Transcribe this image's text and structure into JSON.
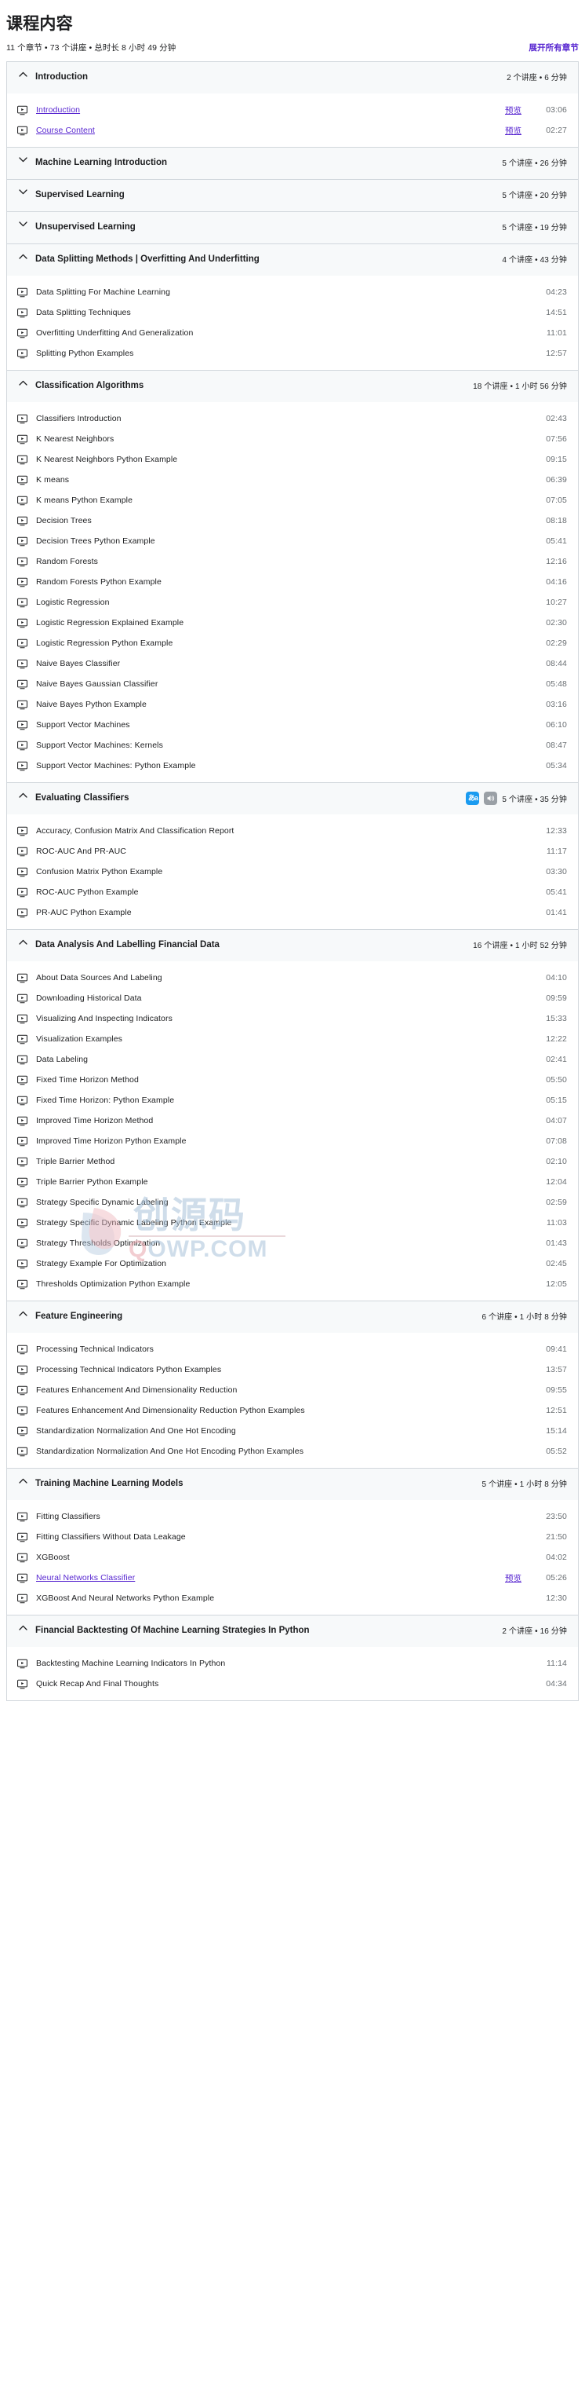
{
  "header": {
    "title": "课程内容",
    "meta": "11 个章节 • 73 个讲座 • 总时长 8 小时 49 分钟",
    "expand_all": "展开所有章节"
  },
  "watermark": {
    "cn": "创源码",
    "domain_prefix": "Q",
    "domain_rest": "OWP.COM"
  },
  "labels": {
    "preview": "预览"
  },
  "colors": {
    "accent": "#5624d0",
    "section_bg": "#f7f9fa",
    "border": "#d1d7dc",
    "duration": "#6a6f73",
    "badge_translate": "#1a9bf0",
    "badge_speaker": "#9aa0a6"
  },
  "sections": [
    {
      "title": "Introduction",
      "meta": "2 个讲座 • 6 分钟",
      "expanded": true,
      "badges": [],
      "lectures": [
        {
          "title": "Introduction",
          "duration": "03:06",
          "link": true,
          "preview": "预览"
        },
        {
          "title": "Course Content",
          "duration": "02:27",
          "link": true,
          "preview": "预览"
        }
      ]
    },
    {
      "title": "Machine Learning Introduction",
      "meta": "5 个讲座 • 26 分钟",
      "expanded": false,
      "badges": [],
      "lectures": []
    },
    {
      "title": "Supervised Learning",
      "meta": "5 个讲座 • 20 分钟",
      "expanded": false,
      "badges": [],
      "lectures": []
    },
    {
      "title": "Unsupervised Learning",
      "meta": "5 个讲座 • 19 分钟",
      "expanded": false,
      "badges": [],
      "lectures": []
    },
    {
      "title": "Data Splitting Methods | Overfitting And Underfitting",
      "meta": "4 个讲座 • 43 分钟",
      "expanded": true,
      "badges": [],
      "lectures": [
        {
          "title": "Data Splitting For Machine Learning",
          "duration": "04:23",
          "link": false,
          "preview": ""
        },
        {
          "title": "Data Splitting Techniques",
          "duration": "14:51",
          "link": false,
          "preview": ""
        },
        {
          "title": "Overfitting Underfitting And Generalization",
          "duration": "11:01",
          "link": false,
          "preview": ""
        },
        {
          "title": "Splitting Python Examples",
          "duration": "12:57",
          "link": false,
          "preview": ""
        }
      ]
    },
    {
      "title": "Classification Algorithms",
      "meta": "18 个讲座 • 1 小时 56 分钟",
      "expanded": true,
      "badges": [],
      "lectures": [
        {
          "title": "Classifiers Introduction",
          "duration": "02:43",
          "link": false,
          "preview": ""
        },
        {
          "title": "K Nearest Neighbors",
          "duration": "07:56",
          "link": false,
          "preview": ""
        },
        {
          "title": "K Nearest Neighbors Python Example",
          "duration": "09:15",
          "link": false,
          "preview": ""
        },
        {
          "title": "K means",
          "duration": "06:39",
          "link": false,
          "preview": ""
        },
        {
          "title": "K means Python Example",
          "duration": "07:05",
          "link": false,
          "preview": ""
        },
        {
          "title": "Decision Trees",
          "duration": "08:18",
          "link": false,
          "preview": ""
        },
        {
          "title": "Decision Trees Python Example",
          "duration": "05:41",
          "link": false,
          "preview": ""
        },
        {
          "title": "Random Forests",
          "duration": "12:16",
          "link": false,
          "preview": ""
        },
        {
          "title": "Random Forests Python Example",
          "duration": "04:16",
          "link": false,
          "preview": ""
        },
        {
          "title": "Logistic Regression",
          "duration": "10:27",
          "link": false,
          "preview": ""
        },
        {
          "title": "Logistic Regression Explained Example",
          "duration": "02:30",
          "link": false,
          "preview": ""
        },
        {
          "title": "Logistic Regression Python Example",
          "duration": "02:29",
          "link": false,
          "preview": ""
        },
        {
          "title": "Naive Bayes Classifier",
          "duration": "08:44",
          "link": false,
          "preview": ""
        },
        {
          "title": "Naive Bayes Gaussian Classifier",
          "duration": "05:48",
          "link": false,
          "preview": ""
        },
        {
          "title": "Naive Bayes Python Example",
          "duration": "03:16",
          "link": false,
          "preview": ""
        },
        {
          "title": "Support Vector Machines",
          "duration": "06:10",
          "link": false,
          "preview": ""
        },
        {
          "title": "Support Vector Machines: Kernels",
          "duration": "08:47",
          "link": false,
          "preview": ""
        },
        {
          "title": "Support Vector Machines: Python Example",
          "duration": "05:34",
          "link": false,
          "preview": ""
        }
      ]
    },
    {
      "title": "Evaluating Classifiers",
      "meta": "5 个讲座 • 35 分钟",
      "expanded": true,
      "badges": [
        "translate-badge",
        "speaker-badge"
      ],
      "lectures": [
        {
          "title": "Accuracy, Confusion Matrix And Classification Report",
          "duration": "12:33",
          "link": false,
          "preview": ""
        },
        {
          "title": "ROC-AUC And PR-AUC",
          "duration": "11:17",
          "link": false,
          "preview": ""
        },
        {
          "title": "Confusion Matrix Python Example",
          "duration": "03:30",
          "link": false,
          "preview": ""
        },
        {
          "title": "ROC-AUC Python Example",
          "duration": "05:41",
          "link": false,
          "preview": ""
        },
        {
          "title": "PR-AUC Python Example",
          "duration": "01:41",
          "link": false,
          "preview": ""
        }
      ]
    },
    {
      "title": "Data Analysis And Labelling Financial Data",
      "meta": "16 个讲座 • 1 小时 52 分钟",
      "expanded": true,
      "badges": [],
      "lectures": [
        {
          "title": "About Data Sources And Labeling",
          "duration": "04:10",
          "link": false,
          "preview": ""
        },
        {
          "title": "Downloading Historical Data",
          "duration": "09:59",
          "link": false,
          "preview": ""
        },
        {
          "title": "Visualizing And Inspecting Indicators",
          "duration": "15:33",
          "link": false,
          "preview": ""
        },
        {
          "title": "Visualization Examples",
          "duration": "12:22",
          "link": false,
          "preview": ""
        },
        {
          "title": "Data Labeling",
          "duration": "02:41",
          "link": false,
          "preview": ""
        },
        {
          "title": "Fixed Time Horizon Method",
          "duration": "05:50",
          "link": false,
          "preview": ""
        },
        {
          "title": "Fixed Time Horizon: Python Example",
          "duration": "05:15",
          "link": false,
          "preview": ""
        },
        {
          "title": "Improved Time Horizon Method",
          "duration": "04:07",
          "link": false,
          "preview": ""
        },
        {
          "title": "Improved Time Horizon Python Example",
          "duration": "07:08",
          "link": false,
          "preview": ""
        },
        {
          "title": "Triple Barrier Method",
          "duration": "02:10",
          "link": false,
          "preview": ""
        },
        {
          "title": "Triple Barrier Python Example",
          "duration": "12:04",
          "link": false,
          "preview": ""
        },
        {
          "title": "Strategy Specific Dynamic Labeling",
          "duration": "02:59",
          "link": false,
          "preview": ""
        },
        {
          "title": "Strategy Specific Dynamic Labeling Python Example",
          "duration": "11:03",
          "link": false,
          "preview": ""
        },
        {
          "title": "Strategy Thresholds Optimization",
          "duration": "01:43",
          "link": false,
          "preview": ""
        },
        {
          "title": "Strategy Example For Optimization",
          "duration": "02:45",
          "link": false,
          "preview": ""
        },
        {
          "title": "Thresholds Optimization Python Example",
          "duration": "12:05",
          "link": false,
          "preview": ""
        }
      ]
    },
    {
      "title": "Feature Engineering",
      "meta": "6 个讲座 • 1 小时 8 分钟",
      "expanded": true,
      "badges": [],
      "lectures": [
        {
          "title": "Processing Technical Indicators",
          "duration": "09:41",
          "link": false,
          "preview": ""
        },
        {
          "title": "Processing Technical Indicators Python Examples",
          "duration": "13:57",
          "link": false,
          "preview": ""
        },
        {
          "title": "Features Enhancement And Dimensionality Reduction",
          "duration": "09:55",
          "link": false,
          "preview": ""
        },
        {
          "title": "Features Enhancement And Dimensionality Reduction Python Examples",
          "duration": "12:51",
          "link": false,
          "preview": ""
        },
        {
          "title": "Standardization Normalization And One Hot Encoding",
          "duration": "15:14",
          "link": false,
          "preview": ""
        },
        {
          "title": "Standardization Normalization And One Hot Encoding Python Examples",
          "duration": "05:52",
          "link": false,
          "preview": ""
        }
      ]
    },
    {
      "title": "Training Machine Learning Models",
      "meta": "5 个讲座 • 1 小时 8 分钟",
      "expanded": true,
      "badges": [],
      "lectures": [
        {
          "title": "Fitting Classifiers",
          "duration": "23:50",
          "link": false,
          "preview": ""
        },
        {
          "title": "Fitting Classifiers Without Data Leakage",
          "duration": "21:50",
          "link": false,
          "preview": ""
        },
        {
          "title": "XGBoost",
          "duration": "04:02",
          "link": false,
          "preview": ""
        },
        {
          "title": "Neural Networks Classifier",
          "duration": "05:26",
          "link": true,
          "preview": "预览"
        },
        {
          "title": "XGBoost And Neural Networks Python Example",
          "duration": "12:30",
          "link": false,
          "preview": ""
        }
      ]
    },
    {
      "title": "Financial Backtesting Of Machine Learning Strategies In Python",
      "meta": "2 个讲座 • 16 分钟",
      "expanded": true,
      "badges": [],
      "lectures": [
        {
          "title": "Backtesting Machine Learning Indicators In Python",
          "duration": "11:14",
          "link": false,
          "preview": ""
        },
        {
          "title": "Quick Recap And Final Thoughts",
          "duration": "04:34",
          "link": false,
          "preview": ""
        }
      ]
    }
  ]
}
